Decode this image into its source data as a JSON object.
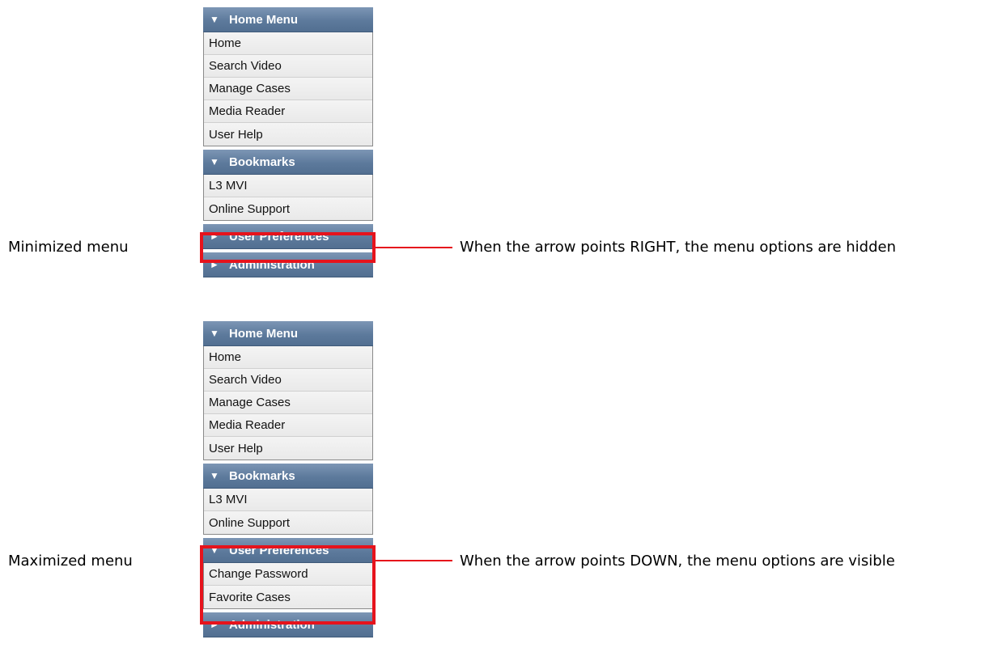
{
  "minimized_example": {
    "label": "Minimized menu",
    "note": "When the arrow points RIGHT, the menu options are hidden",
    "sections": [
      {
        "title": "Home Menu",
        "arrow": "▼",
        "items": [
          "Home",
          "Search Video",
          "Manage Cases",
          "Media Reader",
          "User Help"
        ]
      },
      {
        "title": "Bookmarks",
        "arrow": "▼",
        "items": [
          "L3 MVI",
          "Online Support"
        ]
      },
      {
        "title": "User Preferences",
        "arrow": "►",
        "items": []
      },
      {
        "title": "Administration",
        "arrow": "►",
        "items": []
      }
    ]
  },
  "maximized_example": {
    "label": "Maximized menu",
    "note": "When the arrow points DOWN, the menu options are visible",
    "sections": [
      {
        "title": "Home Menu",
        "arrow": "▼",
        "items": [
          "Home",
          "Search Video",
          "Manage Cases",
          "Media Reader",
          "User Help"
        ]
      },
      {
        "title": "Bookmarks",
        "arrow": "▼",
        "items": [
          "L3 MVI",
          "Online Support"
        ]
      },
      {
        "title": "User Preferences",
        "arrow": "▼",
        "items": [
          "Change Password",
          "Favorite Cases"
        ]
      },
      {
        "title": "Administration",
        "arrow": "►",
        "items": []
      }
    ]
  },
  "colors": {
    "header_bg": "#5d7a9c",
    "highlight": "#e6131c"
  }
}
